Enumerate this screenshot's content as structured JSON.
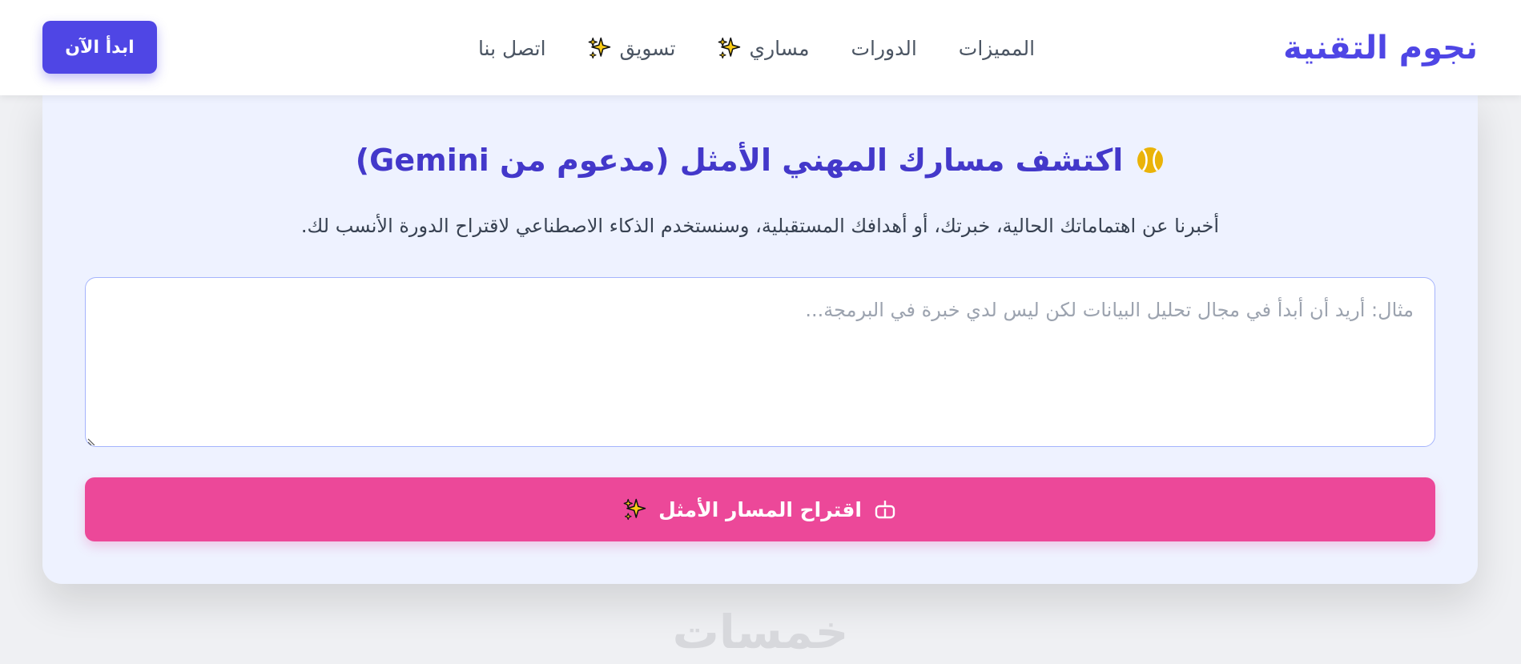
{
  "brand": {
    "name": "نجوم التقنية",
    "color": "#4f46e5"
  },
  "nav": {
    "items": [
      {
        "label": "المميزات",
        "icon": ""
      },
      {
        "label": "الدورات",
        "icon": ""
      },
      {
        "label": "مساري",
        "icon": "sparkles-icon"
      },
      {
        "label": "تسويق",
        "icon": "sparkles-icon"
      },
      {
        "label": "اتصل بنا",
        "icon": ""
      }
    ],
    "cta_label": "ابدأ الآن"
  },
  "card": {
    "title": "اكتشف مسارك المهني الأمثل (مدعوم من Gemini)",
    "title_icon": "ball-icon",
    "description": "أخبرنا عن اهتماماتك الحالية، خبرتك، أو أهدافك المستقبلية، وسنستخدم الذكاء الاصطناعي لاقتراح الدورة الأنسب لك.",
    "input": {
      "value": "",
      "placeholder": "مثال: أريد أن أبدأ في مجال تحليل البيانات لكن ليس لدي خبرة في البرمجة..."
    },
    "button": {
      "label": "اقتراح المسار الأمثل",
      "icons": [
        "robot-icon",
        "sparkles-icon"
      ],
      "color": "#ec4899"
    }
  },
  "watermark": "خمسات",
  "colors": {
    "primary": "#4f46e5",
    "accent": "#ec4899",
    "card_bg": "#eef2ff",
    "sparkle": "#facc15"
  }
}
